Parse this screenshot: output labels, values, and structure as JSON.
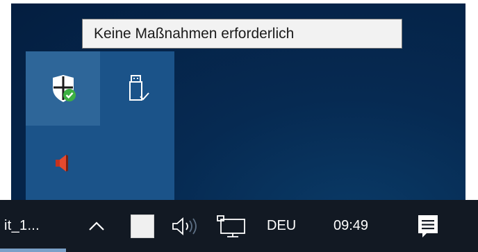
{
  "tooltip": {
    "text": "Keine Maßnahmen erforderlich"
  },
  "overflow": {
    "items": [
      {
        "icon": "windows-security-shield-check-icon"
      },
      {
        "icon": "usb-safely-remove-icon"
      },
      {
        "icon": "speaker-muted-icon"
      }
    ]
  },
  "taskbar": {
    "app_label": "it_1...",
    "show_hidden_icon": "chevron-up-icon",
    "tray_icons": [
      "blank-app-icon",
      "volume-icon",
      "network-icon"
    ],
    "language": "DEU",
    "time": "09:49",
    "action_center_icon": "notification-icon"
  }
}
